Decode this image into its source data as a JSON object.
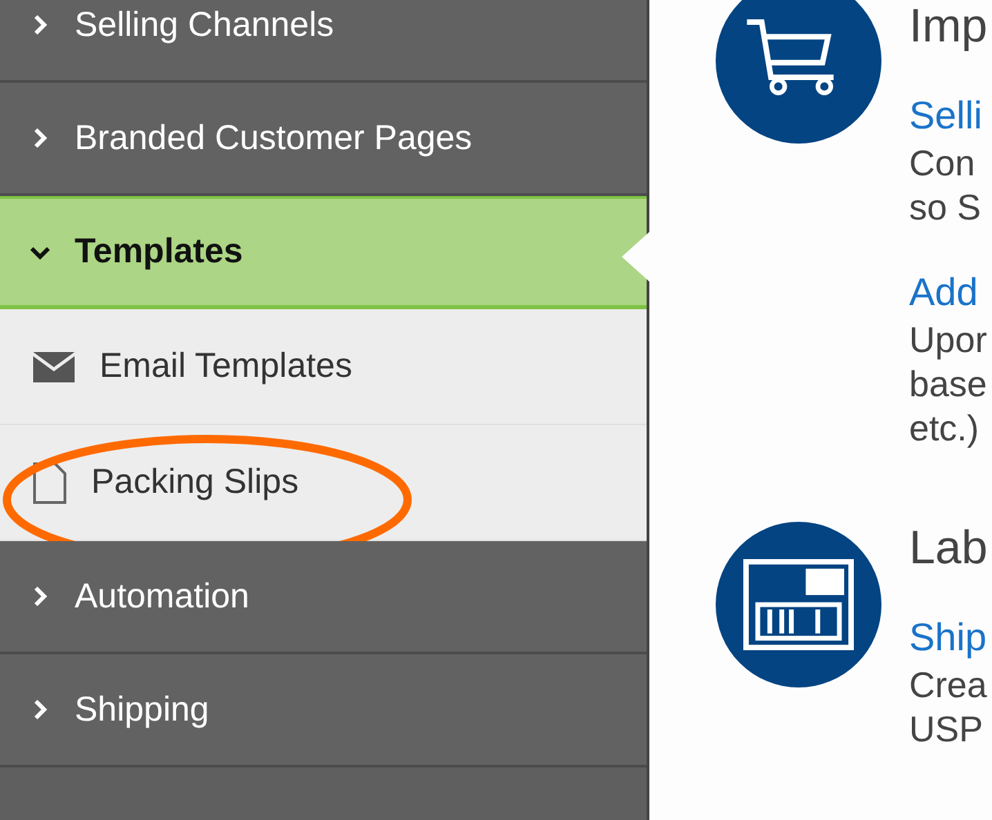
{
  "sidebar": {
    "items": [
      {
        "label": "Selling Channels",
        "expanded": false,
        "selected": false
      },
      {
        "label": "Branded Customer Pages",
        "expanded": false,
        "selected": false
      },
      {
        "label": "Templates",
        "expanded": true,
        "selected": true,
        "children": [
          {
            "label": "Email Templates",
            "kind": "email",
            "circled": false
          },
          {
            "label": "Packing Slips",
            "kind": "document",
            "circled": true
          }
        ]
      },
      {
        "label": "Automation",
        "expanded": false,
        "selected": false
      },
      {
        "label": "Shipping",
        "expanded": false,
        "selected": false
      }
    ]
  },
  "sections": [
    {
      "kind": "cart",
      "heading": "Imp",
      "entries": [
        {
          "link": "Selli",
          "lines": [
            "Con",
            "so S"
          ]
        },
        {
          "link": "Add",
          "lines": [
            "Upor",
            "base",
            "etc.)"
          ]
        }
      ]
    },
    {
      "kind": "label",
      "heading": "Lab",
      "entries": [
        {
          "link": "Ship",
          "lines": [
            "Crea",
            "USP"
          ]
        }
      ]
    }
  ]
}
